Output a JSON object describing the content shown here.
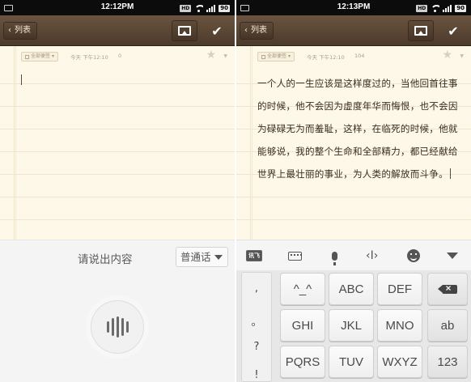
{
  "left": {
    "status_bar": {
      "time": "12:12PM",
      "network": "HD",
      "battery": "90"
    },
    "toolbar": {
      "back_label": "列表",
      "back_icon": "chevron-left-icon",
      "image_icon": "image-icon",
      "done_icon": "checkmark-icon"
    },
    "note_meta": {
      "folder": "全部便签",
      "time": "今天 下午12:10",
      "count": "0"
    },
    "note_text": "",
    "voice_panel": {
      "prompt": "请说出内容",
      "language": "普通话",
      "mic_icon": "voice-wave-icon"
    }
  },
  "right": {
    "status_bar": {
      "time": "12:13PM",
      "network": "HD",
      "battery": "90"
    },
    "toolbar": {
      "back_label": "列表",
      "back_icon": "chevron-left-icon",
      "image_icon": "image-icon",
      "done_icon": "checkmark-icon"
    },
    "note_meta": {
      "folder": "全部便签",
      "time": "今天 下午12:10",
      "count": "104"
    },
    "note_text": "一个人的一生应该是这样度过的，当他回首往事的时候，他不会因为虚度年华而悔恨，也不会因为碌碌无为而羞耻，这样，在临死的时候，他就能够说，我的整个生命和全部精力，都已经献给世界上最壮丽的事业，为人类的解放而斗争。",
    "keyboard": {
      "logo": "讯飞",
      "tools": [
        "keyboard-icon",
        "microphone-icon",
        "cursor-move-icon",
        "emoji-icon",
        "hide-keyboard-icon"
      ],
      "symbols": [
        ",",
        "。",
        "?",
        "!"
      ],
      "rows": [
        [
          "^_^",
          "ABC",
          "DEF"
        ],
        [
          "GHI",
          "JKL",
          "MNO",
          "ab"
        ],
        [
          "PQRS",
          "TUV",
          "WXYZ",
          "123"
        ]
      ],
      "backspace_icon": "backspace-icon"
    }
  },
  "colors": {
    "toolbar": "#5a4634",
    "paper": "#fdf8e8",
    "rule": "#efe5cc"
  }
}
